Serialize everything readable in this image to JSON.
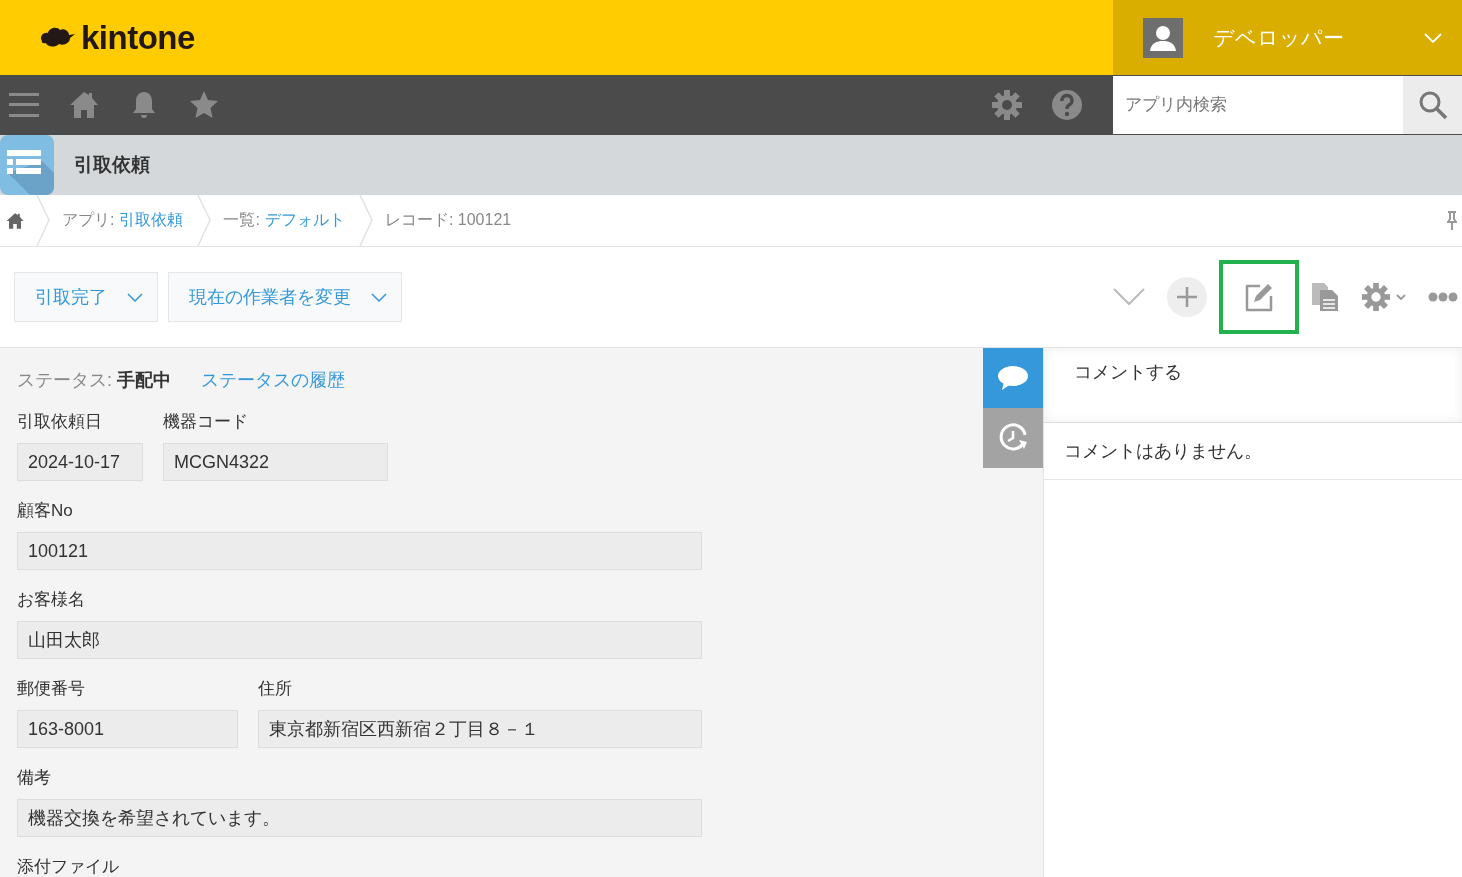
{
  "header": {
    "logo": "kintone",
    "user": "デベロッパー"
  },
  "navbar": {
    "search": {
      "placeholder": "アプリ内検索"
    }
  },
  "app": {
    "title": "引取依頼"
  },
  "breadcrumb": [
    {
      "prefix": "アプリ:",
      "link": "引取依頼"
    },
    {
      "prefix": "一覧:",
      "link": "デフォルト"
    },
    {
      "prefix": "レコード: 100121"
    }
  ],
  "actions": [
    "引取完了",
    "現在の作業者を変更"
  ],
  "toolbar": {
    "edit_highlighted": true
  },
  "status": {
    "label": "ステータス:",
    "value": "手配中",
    "history_link": "ステータスの履歴"
  },
  "fields": [
    [
      {
        "label": "引取依頼日",
        "value": "2024-10-17",
        "kind": "short"
      },
      {
        "label": "機器コード",
        "value": "MCGN4322",
        "kind": "medium"
      }
    ],
    [
      {
        "label": "顧客No",
        "value": "100121",
        "kind": "long"
      }
    ],
    [
      {
        "label": "お客様名",
        "value": "山田太郎",
        "kind": "long"
      }
    ],
    [
      {
        "label": "郵便番号",
        "value": "163-8001",
        "kind": "postal"
      },
      {
        "label": "住所",
        "value": "東京都新宿区西新宿２丁目８－１",
        "kind": "address"
      }
    ],
    [
      {
        "label": "備考",
        "value": "機器交換を希望されています。",
        "kind": "long"
      }
    ],
    [
      {
        "label": "添付ファイル",
        "kind": "label"
      }
    ]
  ],
  "side_tabs": [
    {
      "kind": "comments",
      "selected": true
    },
    {
      "kind": "history",
      "selected": false
    }
  ],
  "comments": {
    "placeholder": "コメントする",
    "empty": "コメントはありません。"
  }
}
